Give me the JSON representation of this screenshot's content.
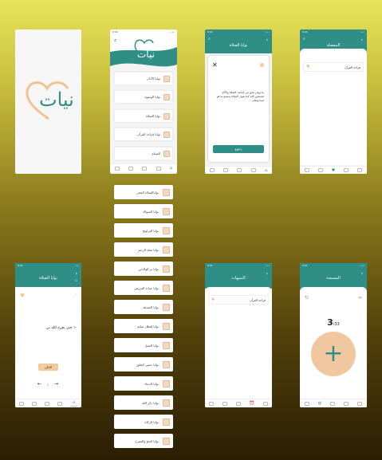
{
  "status": {
    "time": "9:41"
  },
  "logo": {
    "text": "نيات"
  },
  "home": {
    "items": [
      {
        "label": "نوايا الأذان"
      },
      {
        "label": "نوايا الوضوء"
      },
      {
        "label": "نوايا الصلاة"
      },
      {
        "label": "نوايا قراءة القرآن"
      },
      {
        "label": "الصيام"
      },
      {
        "label": "نوايا الاستغفار"
      }
    ]
  },
  "menu": {
    "items": [
      {
        "label": "نواياالصلاة الفجر"
      },
      {
        "label": "نوايا السواك"
      },
      {
        "label": "نوايا التراويح"
      },
      {
        "label": "نوايا صلة الرحم"
      },
      {
        "label": "نوايا بر الوالدين"
      },
      {
        "label": "نوايا عيادة المريض"
      },
      {
        "label": "نوايا الصدقة"
      },
      {
        "label": "نوايا إفطار صائم"
      },
      {
        "label": "نوايا العمل"
      },
      {
        "label": "نوايا حسن الخلق"
      },
      {
        "label": "نوايا الدعاء"
      },
      {
        "label": "نوايا ذكر الله"
      },
      {
        "label": "نوايا الزكاة"
      },
      {
        "label": "نوايا الحج والعمرة"
      }
    ]
  },
  "dialog": {
    "title": "نوايا الصلاة",
    "text": "ما نوفي بحق من اتباعه: الصلاة والأكل لتستعين الله كما يقول الصلاة يستمع ما هو فيما وصلم",
    "button": "رجوع"
  },
  "favorites": {
    "title": "المفضلة",
    "item": "قراءة القرآن"
  },
  "detail": {
    "title": "نوايا الصلاة",
    "text": "-١ حتى يفرح الله بي",
    "tag": "التالي",
    "page": "١"
  },
  "notes": {
    "title": "التنبيهات",
    "item": "قراءة القرآن"
  },
  "tasbih": {
    "title": "المسبحة",
    "count": "3",
    "total": "/33",
    "plus": "+"
  },
  "tabs": {
    "active_label": "الرئيسية"
  }
}
